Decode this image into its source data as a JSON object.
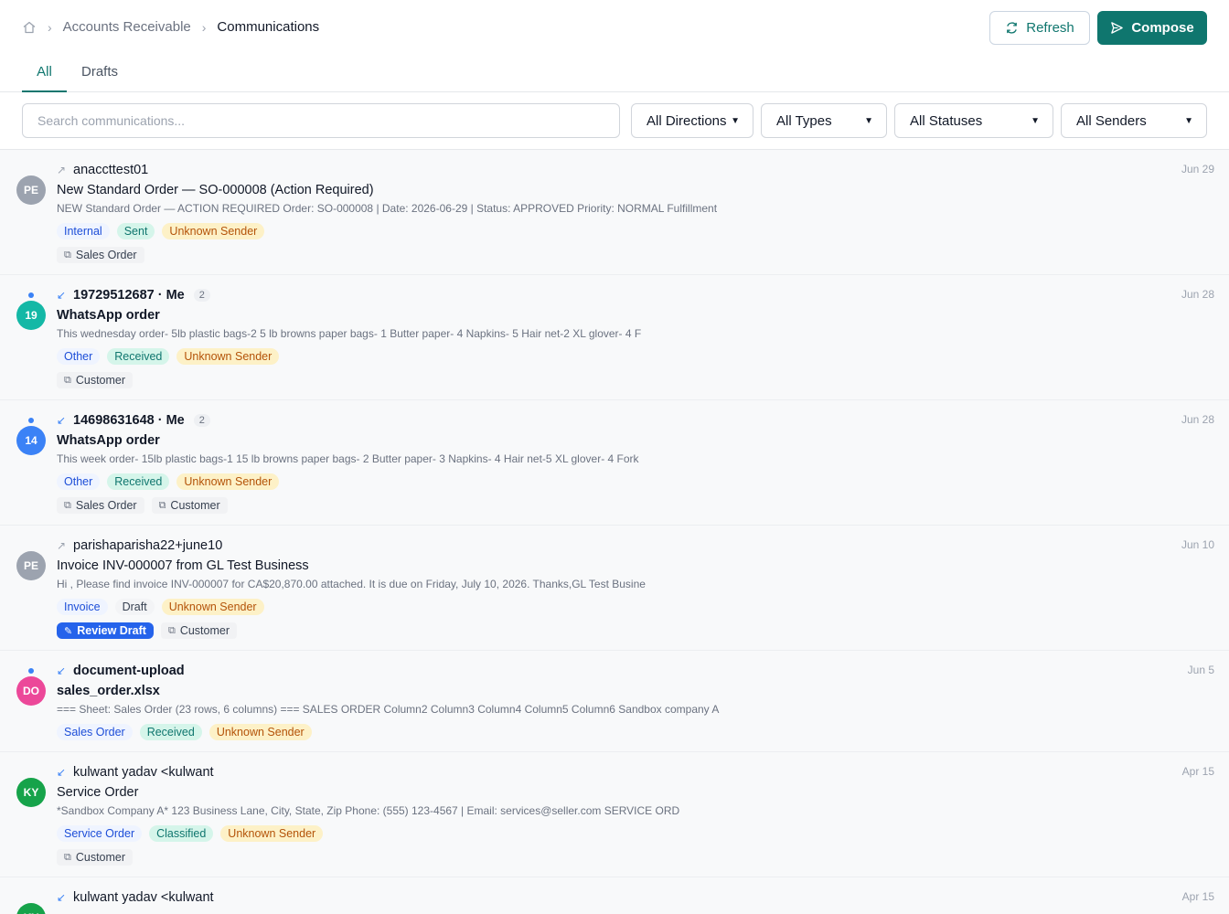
{
  "breadcrumb": {
    "section": "Accounts Receivable",
    "current": "Communications"
  },
  "header": {
    "refresh_label": "Refresh",
    "compose_label": "Compose"
  },
  "tabs": [
    {
      "label": "All"
    },
    {
      "label": "Drafts"
    }
  ],
  "filters": {
    "search_placeholder": "Search communications...",
    "directions": "All Directions",
    "types": "All Types",
    "statuses": "All Statuses",
    "senders": "All Senders"
  },
  "colors": {
    "accent": "#0f766e",
    "info": "#1d4ed8",
    "warning": "#b45309"
  },
  "items": [
    {
      "avatar": "PE",
      "avatar_color": "#9ca3af",
      "unread": false,
      "direction": "outbound",
      "sender": "anaccttest01",
      "count": "",
      "date": "Jun 29",
      "subject": "New Standard Order — SO-000008 (Action Required)",
      "preview": "NEW Standard Order — ACTION REQUIRED Order: SO-000008 | Date: 2026-06-29 | Status: APPROVED Priority: NORMAL Fulfillment",
      "type": "Internal",
      "status": "Sent",
      "sender_flag": "Unknown Sender",
      "links": [
        "Sales Order"
      ],
      "action": ""
    },
    {
      "avatar": "19",
      "avatar_color": "#14b8a6",
      "unread": true,
      "direction": "inbound",
      "sender": "19729512687 · Me",
      "count": "2",
      "date": "Jun 28",
      "subject": "WhatsApp order",
      "preview": "This wednesday order- 5lb plastic bags-2 5 lb browns paper bags- 1 Butter paper- 4 Napkins- 5 Hair net-2 XL glover- 4 F",
      "type": "Other",
      "status": "Received",
      "sender_flag": "Unknown Sender",
      "links": [
        "Customer"
      ],
      "action": ""
    },
    {
      "avatar": "14",
      "avatar_color": "#3b82f6",
      "unread": true,
      "direction": "inbound",
      "sender": "14698631648 · Me",
      "count": "2",
      "date": "Jun 28",
      "subject": "WhatsApp order",
      "preview": "This week order- 15lb plastic bags-1 15 lb browns paper bags- 2 Butter paper- 3 Napkins- 4 Hair net-5 XL glover- 4 Fork",
      "type": "Other",
      "status": "Received",
      "sender_flag": "Unknown Sender",
      "links": [
        "Sales Order",
        "Customer"
      ],
      "action": ""
    },
    {
      "avatar": "PE",
      "avatar_color": "#9ca3af",
      "unread": false,
      "direction": "outbound",
      "sender": "parishaparisha22+june10",
      "count": "",
      "date": "Jun 10",
      "subject": "Invoice INV-000007 from GL Test Business",
      "preview": "Hi , Please find invoice INV-000007 for CA$20,870.00 attached. It is due on Friday, July 10, 2026. Thanks,GL Test Busine",
      "type": "Invoice",
      "status": "Draft",
      "sender_flag": "Unknown Sender",
      "links": [
        "Customer"
      ],
      "action": "Review Draft"
    },
    {
      "avatar": "DO",
      "avatar_color": "#ec4899",
      "unread": true,
      "direction": "inbound",
      "sender": "document-upload",
      "count": "",
      "date": "Jun 5",
      "subject": "sales_order.xlsx",
      "preview": "=== Sheet: Sales Order (23 rows, 6 columns) === SALES ORDER Column2 Column3 Column4 Column5 Column6 Sandbox company A",
      "type": "Sales Order",
      "status": "Received",
      "sender_flag": "Unknown Sender",
      "links": [],
      "action": ""
    },
    {
      "avatar": "KY",
      "avatar_color": "#16a34a",
      "unread": false,
      "direction": "inbound",
      "sender": "kulwant yadav <kulwant",
      "count": "",
      "date": "Apr 15",
      "subject": "Service Order",
      "preview": "*Sandbox Company A* 123 Business Lane, City, State, Zip Phone: (555) 123-4567 | Email: services@seller.com SERVICE ORD",
      "type": "Service Order",
      "status": "Classified",
      "sender_flag": "Unknown Sender",
      "links": [
        "Customer"
      ],
      "action": ""
    },
    {
      "avatar": "KY",
      "avatar_color": "#16a34a",
      "unread": false,
      "direction": "inbound",
      "sender": "kulwant yadav <kulwant",
      "count": "",
      "date": "Apr 15",
      "subject": "",
      "preview": "",
      "type": "",
      "status": "",
      "sender_flag": "",
      "links": [],
      "action": ""
    }
  ]
}
